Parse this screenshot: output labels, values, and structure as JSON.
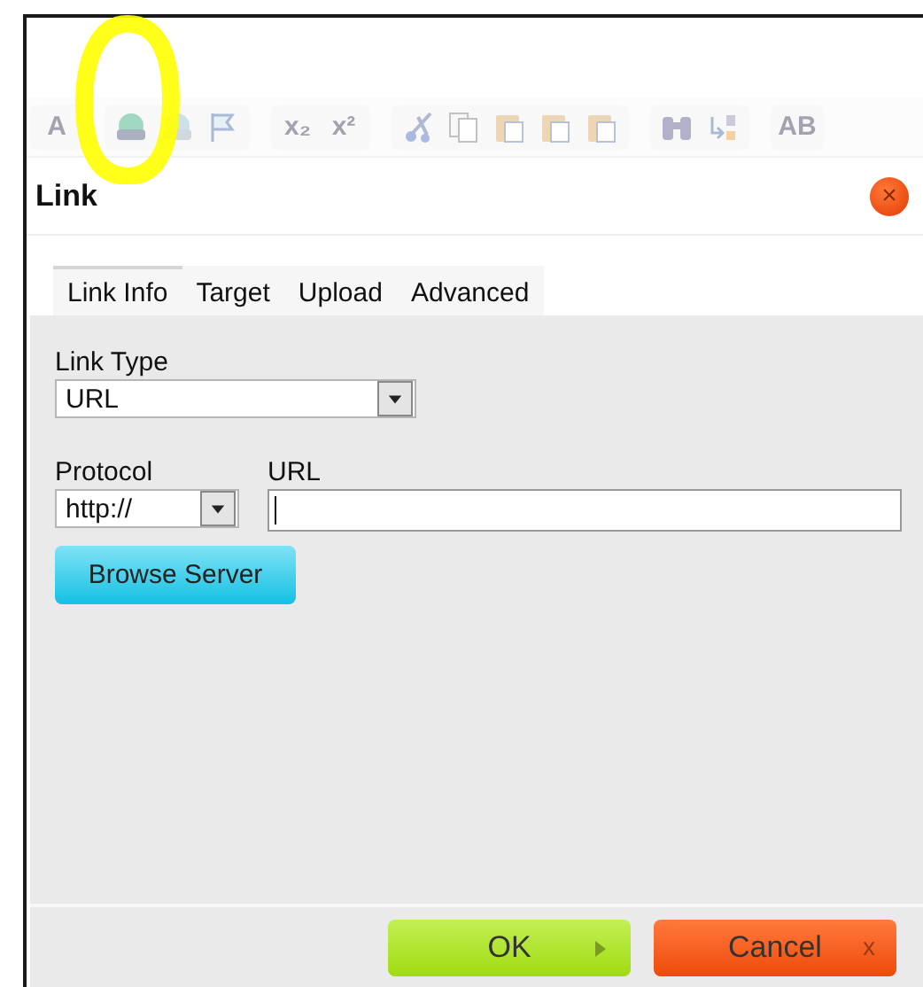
{
  "toolbar": {
    "items": [
      {
        "kind": "font-color",
        "label": "A"
      },
      {
        "kind": "link"
      },
      {
        "kind": "unlink"
      },
      {
        "kind": "anchor"
      },
      {
        "kind": "text",
        "label": "x₂"
      },
      {
        "kind": "text",
        "label": "x²"
      },
      {
        "kind": "cut"
      },
      {
        "kind": "copy"
      },
      {
        "kind": "paste"
      },
      {
        "kind": "paste"
      },
      {
        "kind": "paste"
      },
      {
        "kind": "find"
      },
      {
        "kind": "replace"
      },
      {
        "kind": "spell",
        "label": "AB"
      }
    ]
  },
  "dialog": {
    "title": "Link",
    "close": "×",
    "tabs": [
      {
        "label": "Link Info",
        "selected": true
      },
      {
        "label": "Target",
        "selected": false
      },
      {
        "label": "Upload",
        "selected": false
      },
      {
        "label": "Advanced",
        "selected": false
      }
    ],
    "link_type": {
      "label": "Link Type",
      "value": "URL"
    },
    "protocol": {
      "label": "Protocol",
      "value": "http://"
    },
    "url": {
      "label": "URL",
      "focused": true
    },
    "browse_button": "Browse Server",
    "buttons": [
      {
        "kind": "ok",
        "label": "OK"
      },
      {
        "kind": "cancel",
        "label": "Cancel",
        "mark": "x"
      }
    ]
  }
}
